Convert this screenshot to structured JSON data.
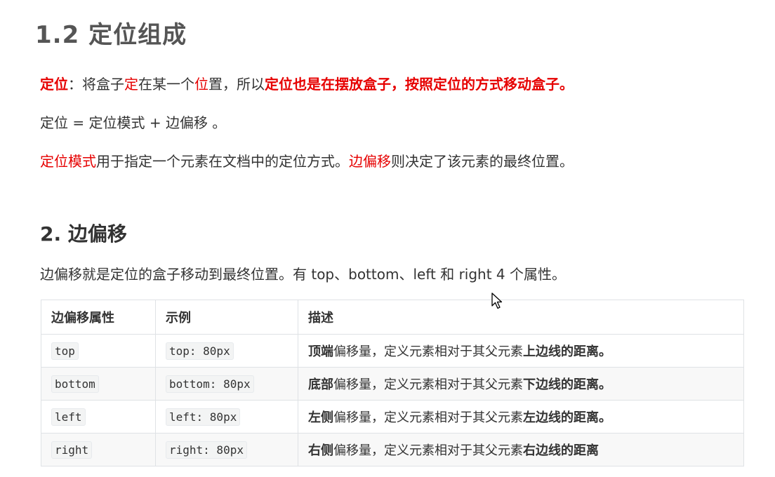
{
  "section1": {
    "heading": "1.2 定位组成",
    "para1": {
      "term": "定位",
      "colon": "：将盒子",
      "ding": "定",
      "mid": "在某一个",
      "wei": "位",
      "tail": "置，所以",
      "highlight": "定位也是在摆放盒子，按照定位的方式移动盒子。"
    },
    "para2": "定位 = 定位模式 + 边偏移 。",
    "para3": {
      "term1": "定位模式",
      "text1": "用于指定一个元素在文档中的定位方式。",
      "term2": "边偏移",
      "text2": "则决定了该元素的最终位置。"
    }
  },
  "section2": {
    "heading": "2. 边偏移",
    "intro": "边偏移就是定位的盒子移动到最终位置。有 top、bottom、left 和 right  4 个属性。",
    "table": {
      "headers": [
        "边偏移属性",
        "示例",
        "描述"
      ],
      "rows": [
        {
          "prop": "top",
          "example": "top: 80px",
          "desc_bold1": "顶端",
          "desc_mid": "偏移量，定义元素相对于其父元素",
          "desc_bold2": "上边线的距离。"
        },
        {
          "prop": "bottom",
          "example": "bottom: 80px",
          "desc_bold1": "底部",
          "desc_mid": "偏移量，定义元素相对于其父元素",
          "desc_bold2": "下边线的距离。"
        },
        {
          "prop": "left",
          "example": "left: 80px",
          "desc_bold1": "左侧",
          "desc_mid": "偏移量，定义元素相对于其父元素",
          "desc_bold2": "左边线的距离。"
        },
        {
          "prop": "right",
          "example": "right: 80px",
          "desc_bold1": "右侧",
          "desc_mid": "偏移量，定义元素相对于其父元素",
          "desc_bold2": "右边线的距离"
        }
      ]
    }
  },
  "colors": {
    "accent_red": "#e60000",
    "text": "#333333",
    "heading_gray": "#555555",
    "table_border": "#dfe2e5",
    "row_stripe": "#f8f8f8"
  },
  "icons": {
    "cursor": "mouse-pointer-icon"
  }
}
